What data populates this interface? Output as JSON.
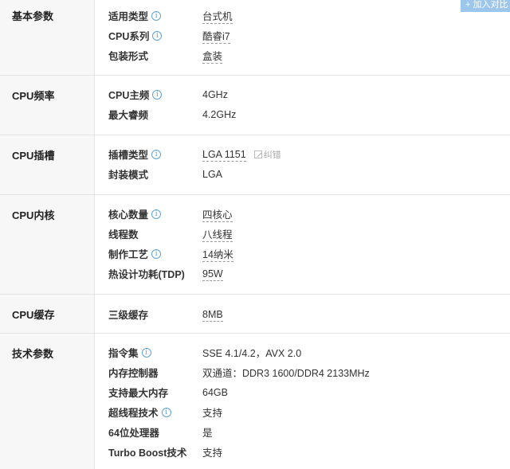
{
  "compare_button": "+ 加入对比",
  "sections": [
    {
      "title": "基本参数",
      "rows": [
        {
          "label": "适用类型",
          "info": true,
          "value": "台式机",
          "linked": true
        },
        {
          "label": "CPU系列",
          "info": true,
          "value": "酷睿i7",
          "linked": true
        },
        {
          "label": "包装形式",
          "info": false,
          "value": "盒装",
          "linked": true
        }
      ]
    },
    {
      "title": "CPU频率",
      "rows": [
        {
          "label": "CPU主频",
          "info": true,
          "value": "4GHz",
          "linked": false
        },
        {
          "label": "最大睿频",
          "info": false,
          "value": "4.2GHz",
          "linked": false
        }
      ]
    },
    {
      "title": "CPU插槽",
      "rows": [
        {
          "label": "插槽类型",
          "info": true,
          "value": "LGA 1151",
          "linked": true,
          "correct": "纠错"
        },
        {
          "label": "封装模式",
          "info": false,
          "value": "LGA",
          "linked": false
        }
      ]
    },
    {
      "title": "CPU内核",
      "rows": [
        {
          "label": "核心数量",
          "info": true,
          "value": "四核心",
          "linked": true
        },
        {
          "label": "线程数",
          "info": false,
          "value": "八线程",
          "linked": true
        },
        {
          "label": "制作工艺",
          "info": true,
          "value": "14纳米",
          "linked": true
        },
        {
          "label": "热设计功耗(TDP)",
          "info": false,
          "value": "95W",
          "linked": true
        }
      ]
    },
    {
      "title": "CPU缓存",
      "rows": [
        {
          "label": "三级缓存",
          "info": false,
          "value": "8MB",
          "linked": true
        }
      ]
    },
    {
      "title": "技术参数",
      "rows": [
        {
          "label": "指令集",
          "info": true,
          "value": "SSE 4.1/4.2，AVX 2.0",
          "linked": false
        },
        {
          "label": "内存控制器",
          "info": false,
          "value": "双通道：DDR3 1600/DDR4 2133MHz",
          "linked": false
        },
        {
          "label": "支持最大内存",
          "info": false,
          "value": "64GB",
          "linked": false
        },
        {
          "label": "超线程技术",
          "info": true,
          "value": "支持",
          "linked": false
        },
        {
          "label": "64位处理器",
          "info": false,
          "value": "是",
          "linked": false
        },
        {
          "label": "Turbo Boost技术",
          "info": false,
          "value": "支持",
          "linked": false
        }
      ]
    }
  ]
}
